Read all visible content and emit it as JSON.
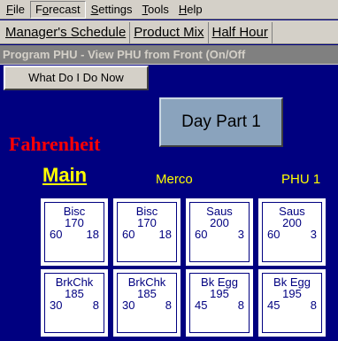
{
  "menu": [
    "File",
    "Forecast",
    "Settings",
    "Tools",
    "Help"
  ],
  "menu_underline": [
    "F",
    "o",
    "S",
    "T",
    "H"
  ],
  "tabs": [
    "Manager's Schedule",
    "Product Mix",
    "Half Hour"
  ],
  "window_title": "Program PHU - View PHU from Front (On/Off",
  "help_button": "What Do I Do Now",
  "daypart_button": "Day Part 1",
  "temperature_unit": "Fahrenheit",
  "columns": {
    "main": "Main",
    "merco": "Merco",
    "phu": "PHU 1"
  },
  "slots": [
    {
      "item": "Bisc",
      "temp": "170",
      "time": "60",
      "qty": "18"
    },
    {
      "item": "Bisc",
      "temp": "170",
      "time": "60",
      "qty": "18"
    },
    {
      "item": "Saus",
      "temp": "200",
      "time": "60",
      "qty": "3"
    },
    {
      "item": "Saus",
      "temp": "200",
      "time": "60",
      "qty": "3"
    },
    {
      "item": "BrkChk",
      "temp": "185",
      "time": "30",
      "qty": "8"
    },
    {
      "item": "BrkChk",
      "temp": "185",
      "time": "30",
      "qty": "8"
    },
    {
      "item": "Bk Egg",
      "temp": "195",
      "time": "45",
      "qty": "8"
    },
    {
      "item": "Bk Egg",
      "temp": "195",
      "time": "45",
      "qty": "8"
    }
  ],
  "colors": {
    "background": "#000080",
    "temperature_unit": "#ff0000",
    "labels": "#ffff00",
    "slot_text": "#000080"
  }
}
